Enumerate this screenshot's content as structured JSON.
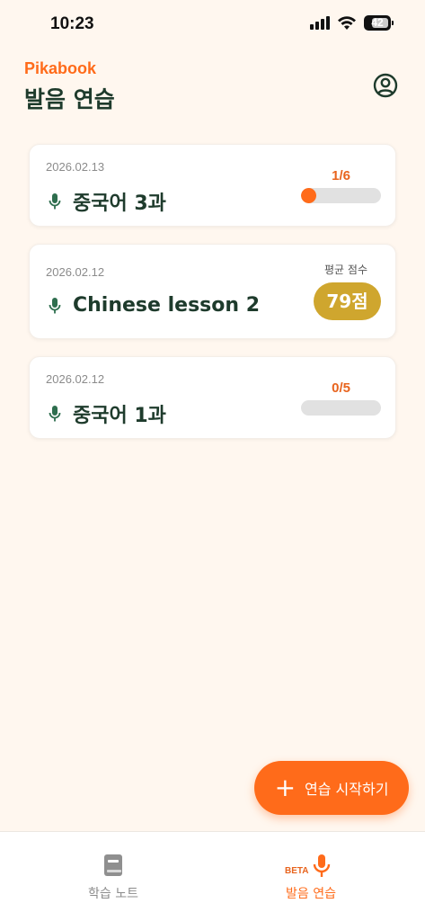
{
  "status_bar": {
    "time": "10:23",
    "battery": "42"
  },
  "header": {
    "brand": "Pikabook",
    "title": "발음 연습"
  },
  "colors": {
    "accent": "#FF6B1A",
    "dark_green": "#1E3B2C",
    "gold": "#CFA62E",
    "background": "#FFF7EF"
  },
  "lessons": [
    {
      "date": "2026.02.13",
      "title": "중국어 3과",
      "progress_label": "1/6",
      "progress_fraction": 0.1667
    },
    {
      "date": "2026.02.12",
      "title": "Chinese lesson 2",
      "score_label": "평균 점수",
      "score": "79점"
    },
    {
      "date": "2026.02.12",
      "title": "중국어 1과",
      "progress_label": "0/5",
      "progress_fraction": 0
    }
  ],
  "fab": {
    "label": "연습 시작하기",
    "icon": "plus-icon"
  },
  "tabs": [
    {
      "label": "학습 노트",
      "icon": "notebook-icon"
    },
    {
      "label": "발음 연습",
      "icon": "mic-icon",
      "badge": "BETA"
    }
  ]
}
